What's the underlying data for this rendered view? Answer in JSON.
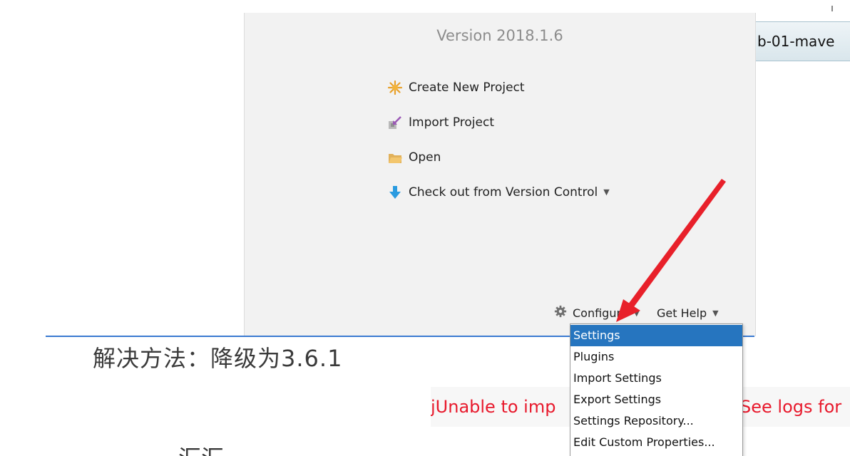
{
  "welcome": {
    "version": "Version 2018.1.6",
    "actions": [
      {
        "label": "Create New Project",
        "icon": "create-new-project-icon"
      },
      {
        "label": "Import Project",
        "icon": "import-project-icon"
      },
      {
        "label": "Open",
        "icon": "folder-open-icon"
      },
      {
        "label": "Check out from Version Control",
        "icon": "download-arrow-icon"
      }
    ],
    "configure_label": "Configure",
    "get_help_label": "Get Help"
  },
  "tab_fragment": {
    "label": "b-01-mave"
  },
  "article": {
    "solution_text": "解决方法：降级为3.6.1",
    "cut_text": "汇汇"
  },
  "error_strip": {
    "left_text": "jUnable to imp",
    "right_text": "See logs for"
  },
  "dropdown": {
    "items": [
      "Settings",
      "Plugins",
      "Import Settings",
      "Export Settings",
      "Settings Repository...",
      "Edit Custom Properties..."
    ],
    "selected_index": 0
  },
  "colors": {
    "selection": "#2675bf",
    "error": "#e8192c",
    "annotation_arrow": "#e8202a",
    "divider": "#3a7ad1"
  }
}
